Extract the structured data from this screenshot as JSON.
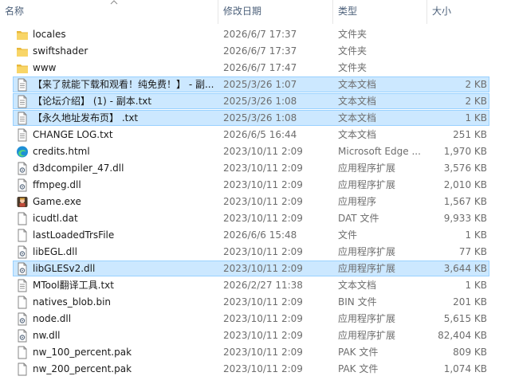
{
  "header": {
    "name": "名称",
    "date": "修改日期",
    "type": "类型",
    "size": "大小"
  },
  "files": [
    {
      "name": "locales",
      "date": "2026/6/7 17:37",
      "type": "文件夹",
      "size": "",
      "icon": "folder-icon",
      "selected": false
    },
    {
      "name": "swiftshader",
      "date": "2026/6/7 17:37",
      "type": "文件夹",
      "size": "",
      "icon": "folder-icon",
      "selected": false
    },
    {
      "name": "www",
      "date": "2026/6/7 17:47",
      "type": "文件夹",
      "size": "",
      "icon": "folder-icon",
      "selected": false
    },
    {
      "name": "【来了就能下载和观看！纯免费！】 - 副...",
      "date": "2025/3/26 1:07",
      "type": "文本文档",
      "size": "2 KB",
      "icon": "text-file-icon",
      "selected": true
    },
    {
      "name": "【论坛介绍】 (1) - 副本.txt",
      "date": "2025/3/26 1:08",
      "type": "文本文档",
      "size": "2 KB",
      "icon": "text-file-icon",
      "selected": true
    },
    {
      "name": "【永久地址发布页】 .txt",
      "date": "2025/3/26 1:08",
      "type": "文本文档",
      "size": "1 KB",
      "icon": "text-file-icon",
      "selected": true
    },
    {
      "name": "CHANGE LOG.txt",
      "date": "2026/6/5 16:44",
      "type": "文本文档",
      "size": "251 KB",
      "icon": "text-file-icon",
      "selected": false
    },
    {
      "name": "credits.html",
      "date": "2023/10/11 2:09",
      "type": "Microsoft Edge ...",
      "size": "1,970 KB",
      "icon": "edge-icon",
      "selected": false
    },
    {
      "name": "d3dcompiler_47.dll",
      "date": "2023/10/11 2:09",
      "type": "应用程序扩展",
      "size": "3,576 KB",
      "icon": "dll-file-icon",
      "selected": false
    },
    {
      "name": "ffmpeg.dll",
      "date": "2023/10/11 2:09",
      "type": "应用程序扩展",
      "size": "2,010 KB",
      "icon": "dll-file-icon",
      "selected": false
    },
    {
      "name": "Game.exe",
      "date": "2023/10/11 2:09",
      "type": "应用程序",
      "size": "1,567 KB",
      "icon": "game-exe-icon",
      "selected": false
    },
    {
      "name": "icudtl.dat",
      "date": "2023/10/11 2:09",
      "type": "DAT 文件",
      "size": "9,933 KB",
      "icon": "blank-file-icon",
      "selected": false
    },
    {
      "name": "lastLoadedTrsFile",
      "date": "2026/6/6 15:48",
      "type": "文件",
      "size": "1 KB",
      "icon": "blank-file-icon",
      "selected": false
    },
    {
      "name": "libEGL.dll",
      "date": "2023/10/11 2:09",
      "type": "应用程序扩展",
      "size": "77 KB",
      "icon": "dll-file-icon",
      "selected": false
    },
    {
      "name": "libGLESv2.dll",
      "date": "2023/10/11 2:09",
      "type": "应用程序扩展",
      "size": "3,644 KB",
      "icon": "dll-file-icon",
      "selected": true
    },
    {
      "name": "MTool翻译工具.txt",
      "date": "2026/2/27 11:38",
      "type": "文本文档",
      "size": "1 KB",
      "icon": "text-file-icon",
      "selected": false
    },
    {
      "name": "natives_blob.bin",
      "date": "2023/10/11 2:09",
      "type": "BIN 文件",
      "size": "201 KB",
      "icon": "blank-file-icon",
      "selected": false
    },
    {
      "name": "node.dll",
      "date": "2023/10/11 2:09",
      "type": "应用程序扩展",
      "size": "5,615 KB",
      "icon": "dll-file-icon",
      "selected": false
    },
    {
      "name": "nw.dll",
      "date": "2023/10/11 2:09",
      "type": "应用程序扩展",
      "size": "82,404 KB",
      "icon": "dll-file-icon",
      "selected": false
    },
    {
      "name": "nw_100_percent.pak",
      "date": "2023/10/11 2:09",
      "type": "PAK 文件",
      "size": "809 KB",
      "icon": "blank-file-icon",
      "selected": false
    },
    {
      "name": "nw_200_percent.pak",
      "date": "2023/10/11 2:09",
      "type": "PAK 文件",
      "size": "1,074 KB",
      "icon": "blank-file-icon",
      "selected": false
    }
  ]
}
